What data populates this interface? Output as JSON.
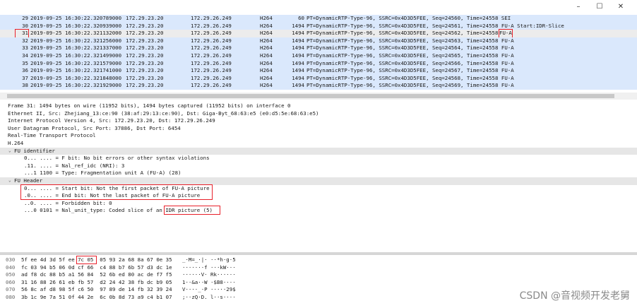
{
  "window": {
    "controls": [
      "–",
      "☐",
      "✕"
    ]
  },
  "packets": [
    {
      "no": "29",
      "time": "2019-09-25 16:30:22.320789000",
      "src": "172.29.23.20",
      "dst": "172.29.26.249",
      "proto": "H264",
      "len": "60",
      "info": "PT=DynamicRTP-Type-96, SSRC=0x4D3D5FEE, Seq=24560, Time=24558 SEI",
      "bg": "#dae8fc"
    },
    {
      "no": "30",
      "time": "2019-09-25 16:30:22.320939000",
      "src": "172.29.23.20",
      "dst": "172.29.26.249",
      "proto": "H264",
      "len": "1494",
      "info": "PT=DynamicRTP-Type-96, SSRC=0x4D3D5FEE, Seq=24561, Time=24558 FU-A Start:IDR-Slice",
      "bg": "#dae8fc"
    },
    {
      "no": "31",
      "time": "2019-09-25 16:30:22.321132000",
      "src": "172.29.23.20",
      "dst": "172.29.26.249",
      "proto": "H264",
      "len": "1494",
      "info": "PT=DynamicRTP-Type-96, SSRC=0x4D3D5FEE, Seq=24562, Time=24558",
      "tail": "FU-A",
      "bg": "#ececec",
      "selected": true
    },
    {
      "no": "32",
      "time": "2019-09-25 16:30:22.321256000",
      "src": "172.29.23.20",
      "dst": "172.29.26.249",
      "proto": "H264",
      "len": "1494",
      "info": "PT=DynamicRTP-Type-96, SSRC=0x4D3D5FEE, Seq=24563, Time=24558 FU-A",
      "bg": "#dae8fc"
    },
    {
      "no": "33",
      "time": "2019-09-25 16:30:22.321337000",
      "src": "172.29.23.20",
      "dst": "172.29.26.249",
      "proto": "H264",
      "len": "1494",
      "info": "PT=DynamicRTP-Type-96, SSRC=0x4D3D5FEE, Seq=24564, Time=24558 FU-A",
      "bg": "#dae8fc"
    },
    {
      "no": "34",
      "time": "2019-09-25 16:30:22.321499000",
      "src": "172.29.23.20",
      "dst": "172.29.26.249",
      "proto": "H264",
      "len": "1494",
      "info": "PT=DynamicRTP-Type-96, SSRC=0x4D3D5FEE, Seq=24565, Time=24558 FU-A",
      "bg": "#dae8fc"
    },
    {
      "no": "35",
      "time": "2019-09-25 16:30:22.321579000",
      "src": "172.29.23.20",
      "dst": "172.29.26.249",
      "proto": "H264",
      "len": "1494",
      "info": "PT=DynamicRTP-Type-96, SSRC=0x4D3D5FEE, Seq=24566, Time=24558 FU-A",
      "bg": "#dae8fc"
    },
    {
      "no": "36",
      "time": "2019-09-25 16:30:22.321741000",
      "src": "172.29.23.20",
      "dst": "172.29.26.249",
      "proto": "H264",
      "len": "1494",
      "info": "PT=DynamicRTP-Type-96, SSRC=0x4D3D5FEE, Seq=24567, Time=24558 FU-A",
      "bg": "#dae8fc"
    },
    {
      "no": "37",
      "time": "2019-09-25 16:30:22.321848000",
      "src": "172.29.23.20",
      "dst": "172.29.26.249",
      "proto": "H264",
      "len": "1494",
      "info": "PT=DynamicRTP-Type-96, SSRC=0x4D3D5FEE, Seq=24568, Time=24558 FU-A",
      "bg": "#dae8fc"
    },
    {
      "no": "38",
      "time": "2019-09-25 16:30:22.321929000",
      "src": "172.29.23.20",
      "dst": "172.29.26.249",
      "proto": "H264",
      "len": "1494",
      "info": "PT=DynamicRTP-Type-96, SSRC=0x4D3D5FEE, Seq=24569, Time=24558 FU-A",
      "bg": "#dae8fc"
    }
  ],
  "details": [
    {
      "indent": 0,
      "text": "Frame 31: 1494 bytes on wire (11952 bits), 1494 bytes captured (11952 bits) on interface 0"
    },
    {
      "indent": 0,
      "text": "Ethernet II, Src: Zhejiang_13:ce:90 (38:af:29:13:ce:90), Dst: Giga-Byt_68:63:e5 (e0:d5:5e:68:63:e5)"
    },
    {
      "indent": 0,
      "text": "Internet Protocol Version 4, Src: 172.29.23.20, Dst: 172.29.26.249"
    },
    {
      "indent": 0,
      "text": "User Datagram Protocol, Src Port: 37886, Dst Port: 6454"
    },
    {
      "indent": 0,
      "text": "Real-Time Transport Protocol"
    },
    {
      "indent": 0,
      "text": "H.264"
    },
    {
      "indent": 1,
      "text": "FU identifier",
      "twisty": "⌄",
      "sel": true
    },
    {
      "indent": 3,
      "text": "0... .... = F bit: No bit errors or other syntax violations"
    },
    {
      "indent": 3,
      "text": ".11. .... = Nal_ref_idc (NRI): 3"
    },
    {
      "indent": 3,
      "text": "...1 1100 = Type: Fragmentation unit A (FU-A) (28)"
    },
    {
      "indent": 1,
      "text": "FU Header",
      "twisty": "⌄",
      "sel": true
    },
    {
      "indent": 3,
      "text": "0... .... = Start bit: Not the first packet of FU-A picture"
    },
    {
      "indent": 3,
      "text": ".0.. .... = End bit: Not the last packet of FU-A picture"
    },
    {
      "indent": 3,
      "text": "..0. .... = Forbidden bit: 0"
    },
    {
      "indent": 3,
      "text": "...0 0101 = Nal_unit_type: Coded slice of an IDR picture (5)"
    }
  ],
  "bytes": [
    {
      "off": "030",
      "hex": "5f ee 4d 3d 5f ee 7c 05  05 93 2a 68 8a 67 0e 35",
      "ascii": "_·M=_·|· ··*h·g·5"
    },
    {
      "off": "040",
      "hex": "fc 03 94 b5 06 0d cf 66  c4 88 b7 6b 57 d3 dc 1e",
      "ascii": "·······f ···kW···"
    },
    {
      "off": "050",
      "hex": "ad f8 dc 88 b5 a1 56 84  52 6b ed 80 ac de f7 f5",
      "ascii": "······V· Rk······"
    },
    {
      "off": "060",
      "hex": "31 16 88 26 61 eb fb 57  d2 24 42 38 fb dc b9 05",
      "ascii": "1··&a··W ·$B8····"
    },
    {
      "off": "070",
      "hex": "56 8c af d8 98 5f c6 50  97 89 de 14 fb 32 39 24",
      "ascii": "V····_·P ·····29$"
    },
    {
      "off": "080",
      "hex": "3b 1c 9e 7a 51 0f 44 2e  6c 0b 8d 73 a9 c4 b1 07",
      "ascii": ";··zQ·D. l··s····"
    }
  ],
  "watermark": "CSDN @音视频开发老舅",
  "colors": {
    "row_bg": "#dae8fc",
    "selected_bg": "#ececec",
    "highlight": "#e8202a"
  }
}
